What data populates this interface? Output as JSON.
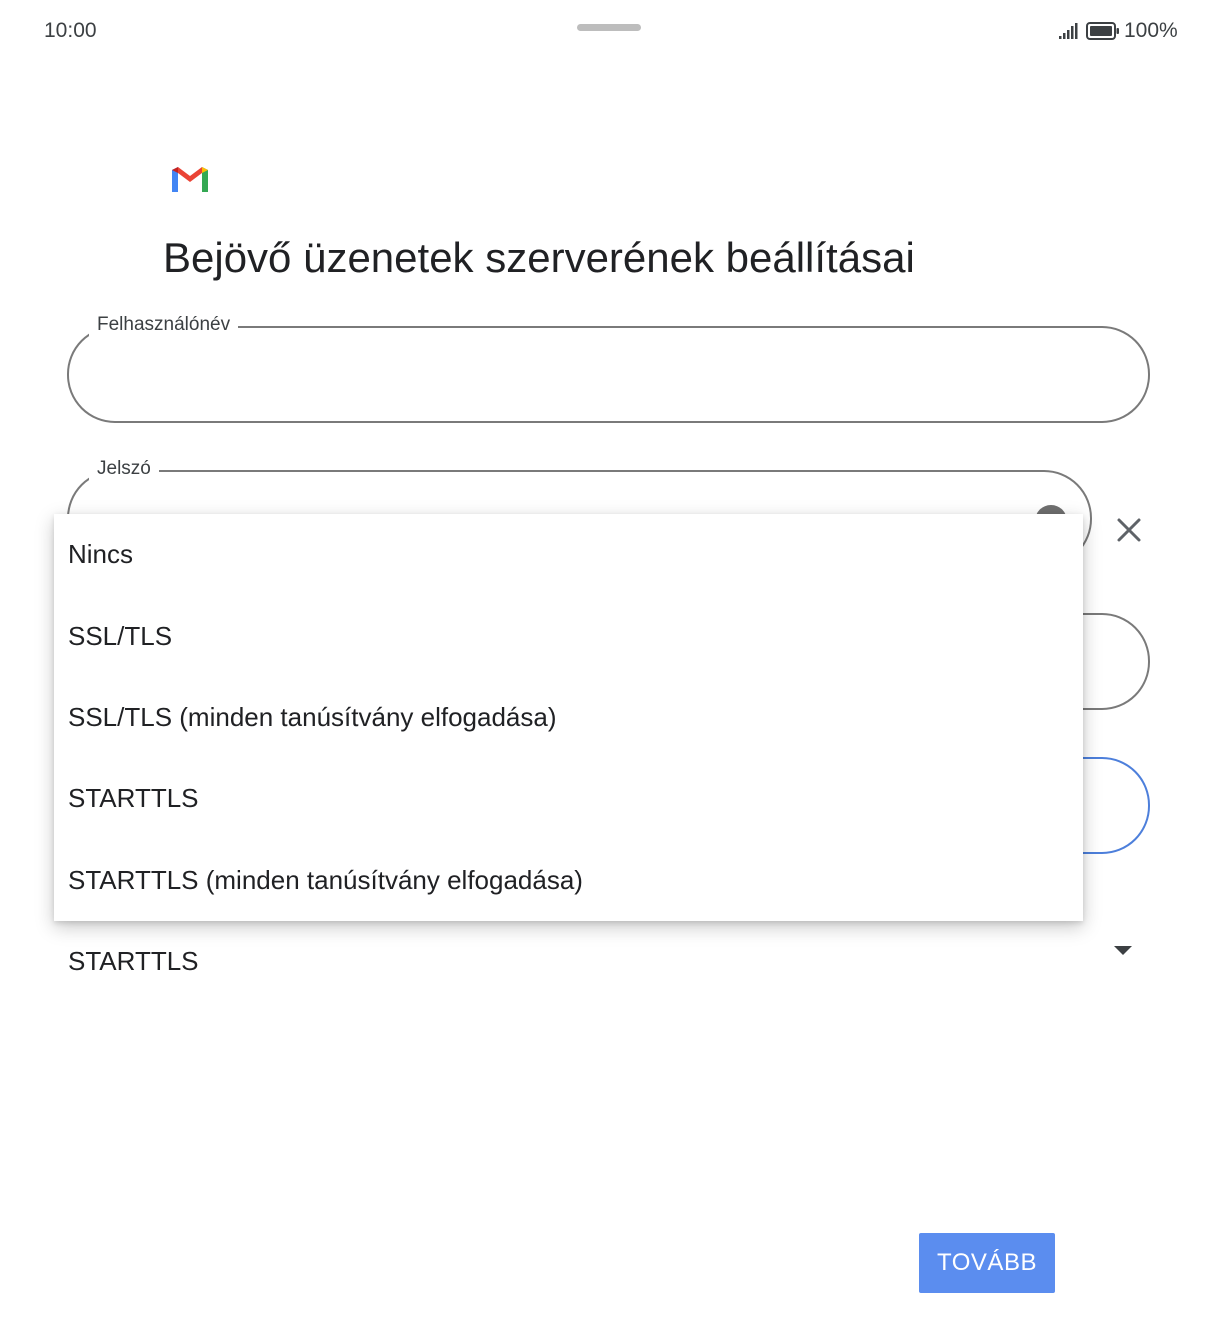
{
  "status_bar": {
    "time": "10:00",
    "battery_percent": "100%",
    "icons": [
      "signal-icon",
      "battery-icon"
    ]
  },
  "header": {
    "logo": "gmail-logo-icon",
    "title": "Bejövő üzenetek szerverének beállításai"
  },
  "form": {
    "username": {
      "label": "Felhasználónév",
      "value": ""
    },
    "password": {
      "label": "Jelszó",
      "value": "",
      "icons": [
        "visibility-icon",
        "close-icon"
      ]
    },
    "server": {
      "value": ""
    },
    "port": {
      "value": "",
      "focused": true
    },
    "security_type": {
      "selected": "STARTTLS",
      "options": [
        "Nincs",
        "SSL/TLS",
        "SSL/TLS (minden tanúsítvány elfogadása)",
        "STARTTLS",
        "STARTTLS (minden tanúsítvány elfogadása)"
      ]
    }
  },
  "actions": {
    "next_label": "TOVÁBB"
  },
  "colors": {
    "accent": "#5b8def",
    "focus_outline": "#4d7fdb",
    "outline": "#7a7a7a"
  }
}
